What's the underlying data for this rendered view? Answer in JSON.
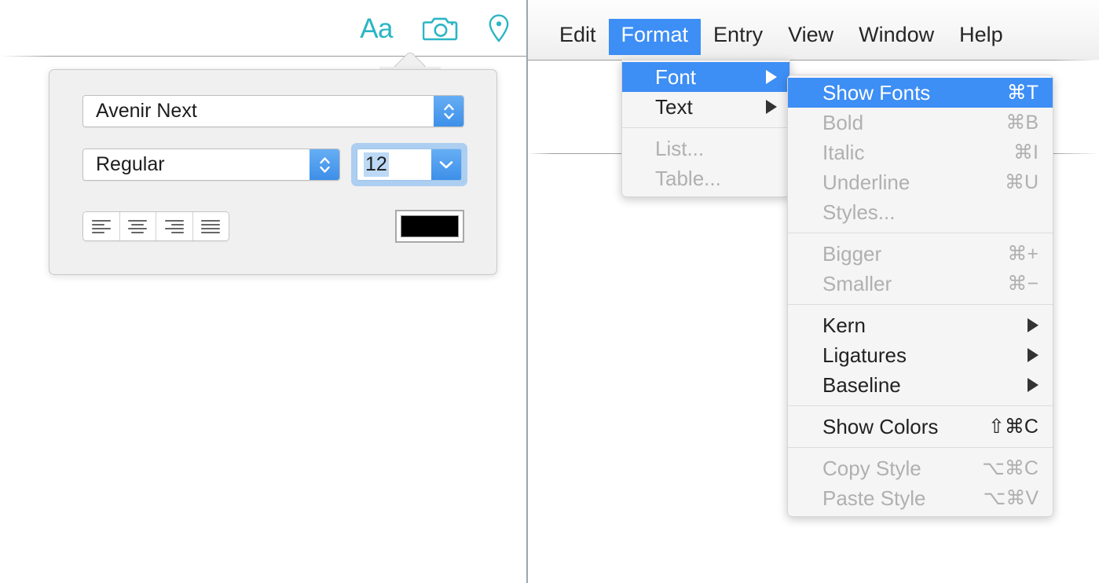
{
  "left_panel": {
    "toolbar": {
      "icons": [
        {
          "name": "text-format-icon",
          "glyph": "Aa",
          "color": "#2bb5c4"
        },
        {
          "name": "camera-icon",
          "glyph": "camera",
          "color": "#2bb5c4"
        },
        {
          "name": "location-pin-icon",
          "glyph": "pin",
          "color": "#2bb5c4"
        }
      ]
    },
    "font_popover": {
      "font_family": "Avenir Next",
      "font_style": "Regular",
      "font_size": "12",
      "alignment_buttons": [
        {
          "name": "align-left-button",
          "label": "Align Left"
        },
        {
          "name": "align-center-button",
          "label": "Align Center"
        },
        {
          "name": "align-right-button",
          "label": "Align Right"
        },
        {
          "name": "align-justify-button",
          "label": "Justify"
        }
      ],
      "text_color": "#000000"
    }
  },
  "right_panel": {
    "menubar": {
      "items": [
        {
          "label": "Edit",
          "active": false
        },
        {
          "label": "Format",
          "active": true
        },
        {
          "label": "Entry",
          "active": false
        },
        {
          "label": "View",
          "active": false
        },
        {
          "label": "Window",
          "active": false
        },
        {
          "label": "Help",
          "active": false
        }
      ]
    },
    "format_menu": {
      "items": [
        {
          "label": "Font",
          "shortcut": "",
          "submenu": true,
          "highlight": true,
          "disabled": false
        },
        {
          "label": "Text",
          "shortcut": "",
          "submenu": true,
          "highlight": false,
          "disabled": false
        },
        {
          "separator": true
        },
        {
          "label": "List...",
          "shortcut": "",
          "submenu": false,
          "highlight": false,
          "disabled": true
        },
        {
          "label": "Table...",
          "shortcut": "",
          "submenu": false,
          "highlight": false,
          "disabled": true
        }
      ]
    },
    "font_submenu": {
      "items": [
        {
          "label": "Show Fonts",
          "shortcut": "⌘T",
          "submenu": false,
          "highlight": true,
          "disabled": false
        },
        {
          "label": "Bold",
          "shortcut": "⌘B",
          "submenu": false,
          "highlight": false,
          "disabled": true
        },
        {
          "label": "Italic",
          "shortcut": "⌘I",
          "submenu": false,
          "highlight": false,
          "disabled": true
        },
        {
          "label": "Underline",
          "shortcut": "⌘U",
          "submenu": false,
          "highlight": false,
          "disabled": true
        },
        {
          "label": "Styles...",
          "shortcut": "",
          "submenu": false,
          "highlight": false,
          "disabled": true
        },
        {
          "separator": true
        },
        {
          "label": "Bigger",
          "shortcut": "⌘+",
          "submenu": false,
          "highlight": false,
          "disabled": true
        },
        {
          "label": "Smaller",
          "shortcut": "⌘−",
          "submenu": false,
          "highlight": false,
          "disabled": true
        },
        {
          "separator": true
        },
        {
          "label": "Kern",
          "shortcut": "",
          "submenu": true,
          "highlight": false,
          "disabled": false
        },
        {
          "label": "Ligatures",
          "shortcut": "",
          "submenu": true,
          "highlight": false,
          "disabled": false
        },
        {
          "label": "Baseline",
          "shortcut": "",
          "submenu": true,
          "highlight": false,
          "disabled": false
        },
        {
          "separator": true
        },
        {
          "label": "Show Colors",
          "shortcut": "⇧⌘C",
          "submenu": false,
          "highlight": false,
          "disabled": false
        },
        {
          "separator": true
        },
        {
          "label": "Copy Style",
          "shortcut": "⌥⌘C",
          "submenu": false,
          "highlight": false,
          "disabled": true
        },
        {
          "label": "Paste Style",
          "shortcut": "⌥⌘V",
          "submenu": false,
          "highlight": false,
          "disabled": true
        }
      ]
    }
  },
  "colors": {
    "accent_blue": "#3d8ef5",
    "icon_teal": "#2bb5c4",
    "menu_bg": "#f5f5f5",
    "popover_bg": "#f0f0f0"
  }
}
